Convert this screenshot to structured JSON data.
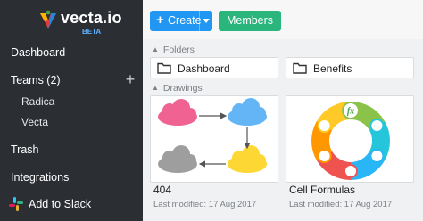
{
  "app": {
    "name": "vecta.io",
    "badge": "BETA"
  },
  "sidebar": {
    "dashboard": "Dashboard",
    "teams": "Teams (2)",
    "teams_add": "+",
    "team_items": [
      "Radica",
      "Vecta"
    ],
    "trash": "Trash",
    "integrations": "Integrations",
    "add_to_slack": "Add to Slack"
  },
  "toolbar": {
    "create_icon": "+",
    "create_label": "Create",
    "members_label": "Members"
  },
  "sections": {
    "folders": "Folders",
    "drawings": "Drawings"
  },
  "folders": [
    {
      "label": "Dashboard",
      "icon": "folder-icon"
    },
    {
      "label": "Benefits",
      "icon": "folder-icon"
    }
  ],
  "drawings": [
    {
      "title": "404",
      "meta": "Last modified: 17 Aug 2017"
    },
    {
      "title": "Cell Formulas",
      "meta": "Last modified: 17 Aug 2017",
      "thumb_label": "fx"
    }
  ],
  "colors": {
    "sidebar_bg": "#2b2e33",
    "create_button": "#2196f3",
    "members_button": "#2ab57d",
    "cloud_pink": "#f06292",
    "cloud_blue": "#64b5f6",
    "cloud_gray": "#9e9e9e",
    "cloud_yellow": "#fdd835"
  }
}
